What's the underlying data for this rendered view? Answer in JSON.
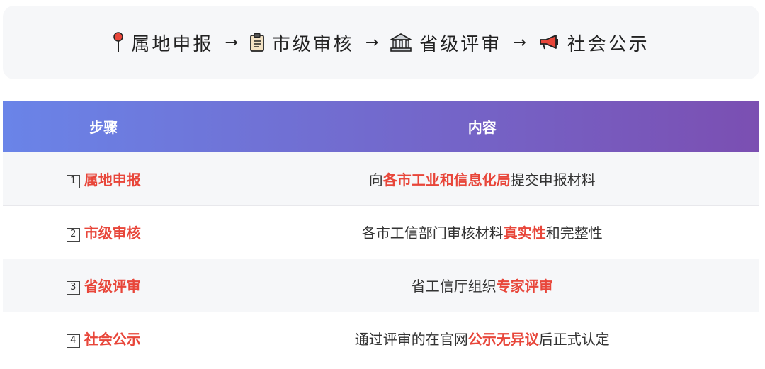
{
  "flow": {
    "steps": [
      {
        "icon": "pushpin-icon",
        "label": "属地申报"
      },
      {
        "icon": "clipboard-icon",
        "label": "市级审核"
      },
      {
        "icon": "bank-icon",
        "label": "省级评审"
      },
      {
        "icon": "megaphone-icon",
        "label": "社会公示"
      }
    ],
    "arrow": "→"
  },
  "table": {
    "headers": {
      "step": "步骤",
      "content": "内容"
    },
    "header_gradient": [
      "#6a84e8",
      "#7b4fb2"
    ],
    "highlight_color": "#e8463a",
    "rows": [
      {
        "num": "1",
        "name": "属地申报",
        "pre": "向",
        "highlight": "各市工业和信息化局",
        "post": "提交申报材料"
      },
      {
        "num": "2",
        "name": "市级审核",
        "pre": "各市工信部门审核材料",
        "highlight": "真实性",
        "post": "和完整性"
      },
      {
        "num": "3",
        "name": "省级评审",
        "pre": "省工信厅组织",
        "highlight": "专家评审",
        "post": ""
      },
      {
        "num": "4",
        "name": "社会公示",
        "pre": "通过评审的在官网",
        "highlight": "公示无异议",
        "post": "后正式认定"
      }
    ]
  }
}
